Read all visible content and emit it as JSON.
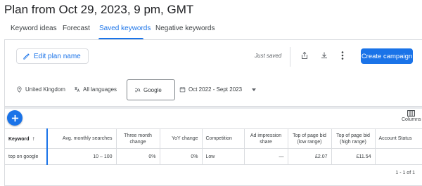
{
  "page": {
    "title": "Plan from Oct 29, 2023, 9 pm, GMT"
  },
  "tabs": [
    {
      "label": "Keyword ideas",
      "active": false
    },
    {
      "label": "Forecast",
      "active": false
    },
    {
      "label": "Saved keywords",
      "active": true
    },
    {
      "label": "Negative keywords",
      "active": false
    }
  ],
  "toolbar": {
    "edit_label": "Edit plan name",
    "saved_status": "Just saved",
    "share_icon": "share-icon",
    "download_icon": "download-icon",
    "more_icon": "more-vert-icon",
    "create_label": "Create campaign"
  },
  "filters": {
    "location": "United Kingdom",
    "language": "All languages",
    "network": "Google",
    "date_range": "Oct 2022 - Sept 2023"
  },
  "table": {
    "columns_label": "Columns",
    "headers": [
      "Keyword",
      "Avg. monthly searches",
      "Three month change",
      "YoY change",
      "Competition",
      "Ad impression share",
      "Top of page bid (low range)",
      "Top of page bid (high range)",
      "Account Status"
    ],
    "rows": [
      {
        "keyword": "top on google",
        "avg_monthly": "10 – 100",
        "three_month": "0%",
        "yoy": "0%",
        "competition": "Low",
        "ad_impression": "—",
        "bid_low": "£2.07",
        "bid_high": "£11.54",
        "account_status": ""
      }
    ],
    "pagination": "1 - 1 of 1"
  },
  "colors": {
    "accent": "#1a73e8",
    "border": "#dadce0",
    "text": "#3c4043"
  }
}
